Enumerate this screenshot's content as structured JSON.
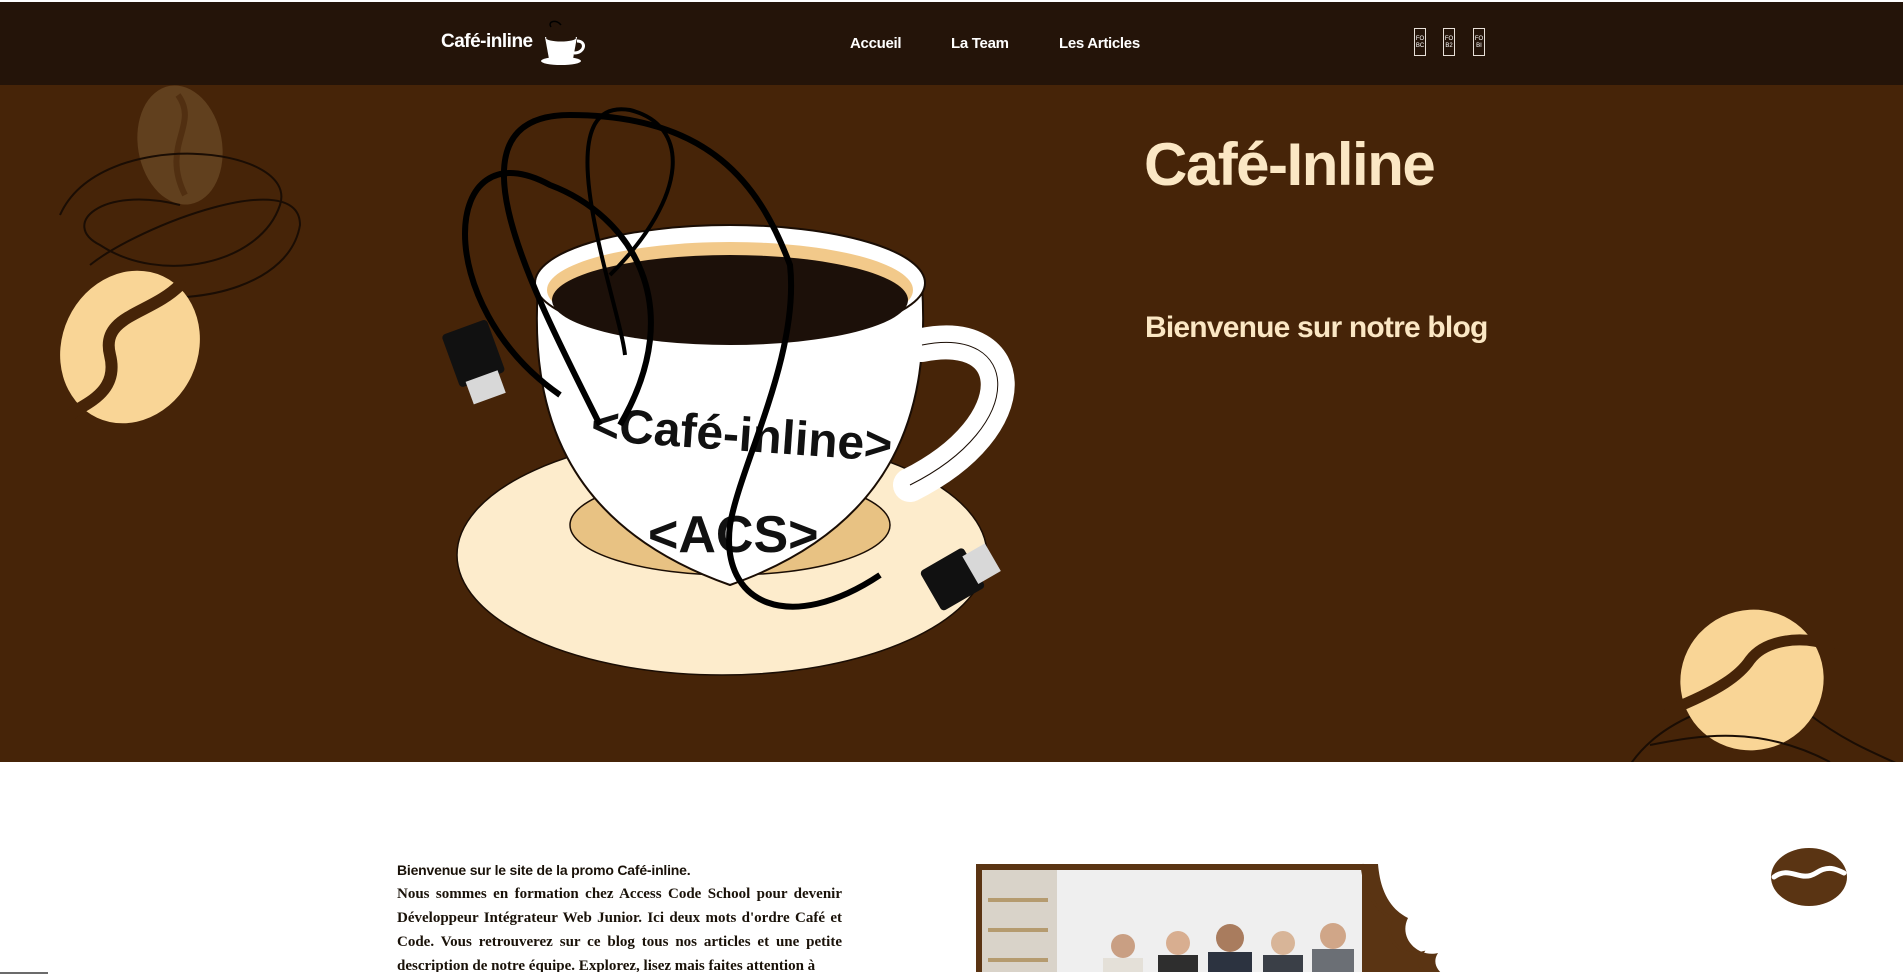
{
  "navbar": {
    "brand": "Café-inline",
    "links": [
      "Accueil",
      "La Team",
      "Les Articles"
    ],
    "social": [
      {
        "name": "facebook-icon",
        "text": "FO BC"
      },
      {
        "name": "twitter-icon",
        "text": "FO B2"
      },
      {
        "name": "instagram-icon",
        "text": "FO BI"
      }
    ]
  },
  "hero": {
    "title": "Café-Inline",
    "subtitle": "Bienvenue sur notre blog",
    "cup_text_1": "<Café-inline>",
    "cup_text_2": "<ACS>"
  },
  "intro": {
    "lead": "Bienvenue sur le site de la promo Café-inline.",
    "body": "Nous sommes en formation chez Access Code School pour devenir Développeur Intégrateur Web Junior. Ici deux mots d'ordre Café et Code. Vous retrouverez sur ce blog tous nos articles et une petite description de notre équipe. Explorez, lisez mais faites attention à"
  },
  "colors": {
    "navbar": "#241409",
    "hero": "#462408",
    "accent": "#fbe7c4",
    "bean_light": "#f9d596",
    "bean_dark": "#5a3413"
  }
}
